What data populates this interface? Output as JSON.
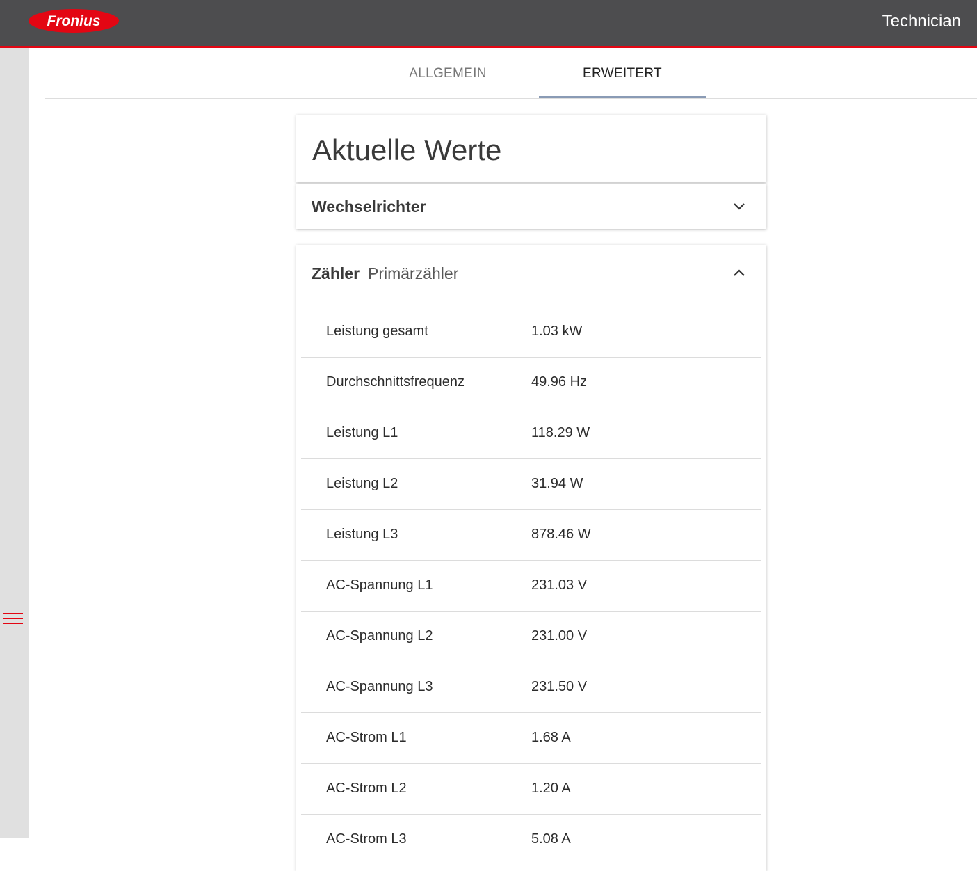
{
  "header": {
    "logo_text": "Fronius",
    "role": "Technician",
    "accent_color": "#e30613",
    "background_color": "#4d4d4f"
  },
  "sidebar": {
    "menu_icon": "hamburger-menu-icon"
  },
  "tabs": [
    {
      "label": "ALLGEMEIN",
      "active": false
    },
    {
      "label": "ERWEITERT",
      "active": true
    }
  ],
  "page": {
    "title": "Aktuelle Werte"
  },
  "inverter_panel": {
    "title": "Wechselrichter",
    "expanded": false,
    "icon": "chevron-down-icon"
  },
  "meter_panel": {
    "title": "Zähler",
    "subtitle": "Primärzähler",
    "expanded": true,
    "icon": "chevron-up-icon",
    "rows": [
      {
        "label": "Leistung gesamt",
        "value": "1.03 kW"
      },
      {
        "label": "Durchschnittsfrequenz",
        "value": "49.96 Hz"
      },
      {
        "label": "Leistung L1",
        "value": "118.29 W"
      },
      {
        "label": "Leistung L2",
        "value": "31.94 W"
      },
      {
        "label": "Leistung L3",
        "value": "878.46 W"
      },
      {
        "label": "AC-Spannung L1",
        "value": "231.03 V"
      },
      {
        "label": "AC-Spannung L2",
        "value": "231.00 V"
      },
      {
        "label": "AC-Spannung L3",
        "value": "231.50 V"
      },
      {
        "label": "AC-Strom L1",
        "value": "1.68 A"
      },
      {
        "label": "AC-Strom L2",
        "value": "1.20 A"
      },
      {
        "label": "AC-Strom L3",
        "value": "5.08 A"
      }
    ]
  }
}
